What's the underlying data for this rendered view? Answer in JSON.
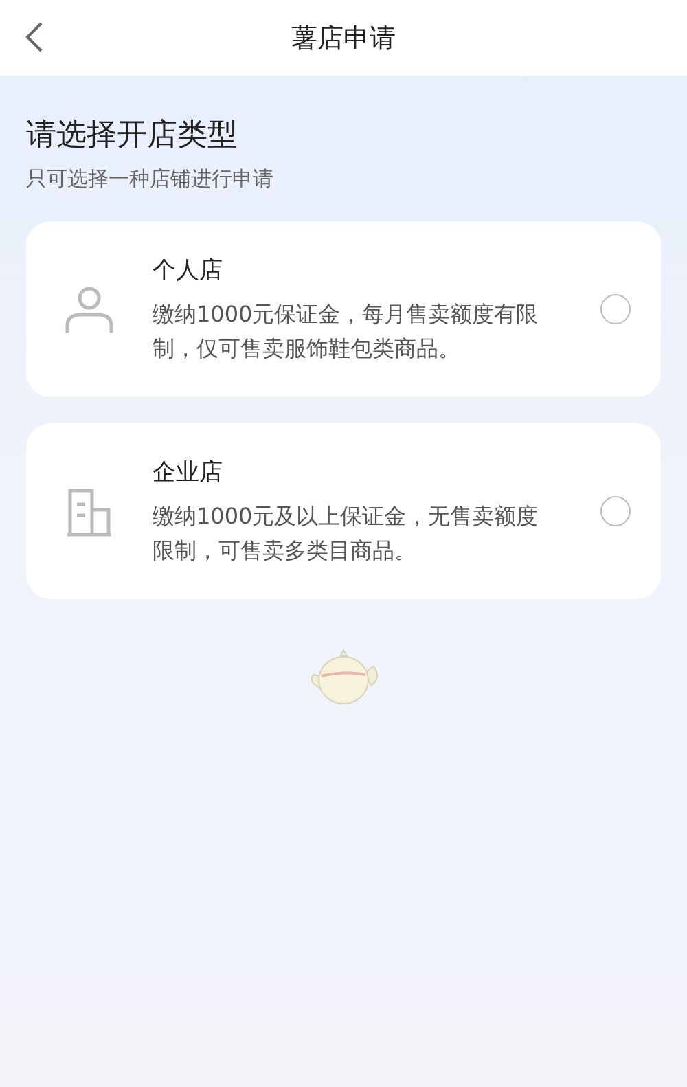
{
  "nav": {
    "title": "薯店申请"
  },
  "heading": "请选择开店类型",
  "subheading": "只可选择一种店铺进行申请",
  "options": [
    {
      "kind": "person",
      "title": "个人店",
      "description": "缴纳1000元保证金，每月售卖额度有限制，仅可售卖服饰鞋包类商品。",
      "selected": false
    },
    {
      "kind": "building",
      "title": "企业店",
      "description": "缴纳1000元及以上保证金，无售卖额度限制，可售卖多类目商品。",
      "selected": false
    }
  ]
}
